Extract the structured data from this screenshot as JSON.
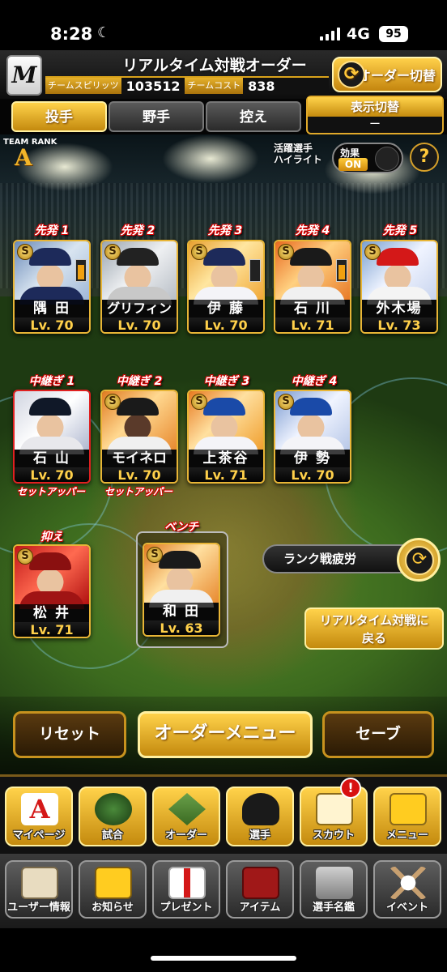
{
  "status_bar": {
    "time": "8:28",
    "network": "4G",
    "battery": "95"
  },
  "header": {
    "team_logo": "M",
    "title": "リアルタイム対戦オーダー",
    "spirits_label": "チームスピリッツ",
    "spirits_value": "103512",
    "cost_label": "チームコスト",
    "cost_value": "838",
    "order_switch_label": "オーダー切替"
  },
  "tabs": [
    {
      "label": "投手",
      "active": true
    },
    {
      "label": "野手",
      "active": false
    },
    {
      "label": "控え",
      "active": false
    }
  ],
  "display_switch": {
    "label": "表示切替",
    "value": "ー"
  },
  "team_rank": {
    "label": "TEAM RANK",
    "rank": "A"
  },
  "highlight": {
    "label_line1": "活躍選手",
    "label_line2": "ハイライト",
    "effect_label": "効果",
    "effect_state": "ON"
  },
  "starters": [
    {
      "slot": "先発 1",
      "name": "隅 田",
      "level": "Lv. 70"
    },
    {
      "slot": "先発 2",
      "name": "グリフィン",
      "level": "Lv. 70"
    },
    {
      "slot": "先発 3",
      "name": "伊 藤",
      "level": "Lv. 70"
    },
    {
      "slot": "先発 4",
      "name": "石 川",
      "level": "Lv. 71"
    },
    {
      "slot": "先発 5",
      "name": "外木場",
      "level": "Lv. 73"
    }
  ],
  "relievers": [
    {
      "slot": "中継ぎ 1",
      "name": "石 山",
      "level": "Lv. 70",
      "note": "セットアッパー"
    },
    {
      "slot": "中継ぎ 2",
      "name": "モイネロ",
      "level": "Lv. 70",
      "note": "セットアッパー"
    },
    {
      "slot": "中継ぎ 3",
      "name": "上茶谷",
      "level": "Lv. 71",
      "note": ""
    },
    {
      "slot": "中継ぎ 4",
      "name": "伊 勢",
      "level": "Lv. 70",
      "note": ""
    }
  ],
  "closer": {
    "slot": "抑え",
    "name": "松 井",
    "level": "Lv. 71"
  },
  "bench": {
    "slot": "ベンチ",
    "name": "和 田",
    "level": "Lv. 63"
  },
  "rank_fatigue_label": "ランク戦疲労",
  "back_button": {
    "line1": "リアルタイム対戦に",
    "line2": "戻る"
  },
  "actions": {
    "reset": "リセット",
    "order_menu": "オーダーメニュー",
    "save": "セーブ"
  },
  "menu_main": [
    {
      "label": "マイページ",
      "icon": "mypage-icon"
    },
    {
      "label": "試合",
      "icon": "stadium-icon"
    },
    {
      "label": "オーダー",
      "icon": "order-field-icon"
    },
    {
      "label": "選手",
      "icon": "player-icon"
    },
    {
      "label": "スカウト",
      "icon": "scout-card-icon"
    },
    {
      "label": "メニュー",
      "icon": "mascot-menu-icon"
    }
  ],
  "scout_badge": "!",
  "menu_sub": [
    {
      "label": "ユーザー情報",
      "icon": "user-card-icon"
    },
    {
      "label": "お知らせ",
      "icon": "notice-mascot-icon"
    },
    {
      "label": "プレゼント",
      "icon": "gift-icon"
    },
    {
      "label": "アイテム",
      "icon": "item-book-icon"
    },
    {
      "label": "選手名鑑",
      "icon": "player-book-icon"
    },
    {
      "label": "イベント",
      "icon": "bats-ball-icon"
    }
  ],
  "colors": {
    "gold": "#e8b536",
    "accent_red": "#d40000",
    "field_green": "#3c6a1e"
  }
}
